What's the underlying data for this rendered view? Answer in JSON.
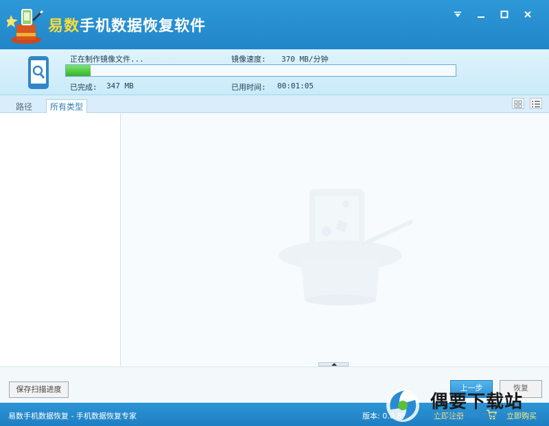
{
  "window": {
    "title_part1": "易数",
    "title_part2": "手机数据恢复软件",
    "controls": [
      "menu-icon",
      "minimize-icon",
      "maximize-icon",
      "close-icon"
    ]
  },
  "progress": {
    "status_text": "正在制作镜像文件...",
    "speed_label": "镜像速度:",
    "speed_value": "370 MB/分钟",
    "completed_label": "已完成:",
    "completed_value": "347 MB",
    "elapsed_label": "已用时间:",
    "elapsed_value": "00:01:05",
    "fill_fraction": 0.064
  },
  "tabs": [
    {
      "label": "路径",
      "active": false
    },
    {
      "label": "所有类型",
      "active": true
    }
  ],
  "view_buttons": [
    "grid-view-icon",
    "list-view-icon"
  ],
  "buttons": {
    "save_scan": "保存扫描进度",
    "prev_step": "上一步",
    "restore": "恢复"
  },
  "statusbar": {
    "left_text": "易数手机数据恢复 - 手机数据恢复专家",
    "version_text": "版本: 0.0.85",
    "register": "立即注册",
    "buy": "立即购买"
  },
  "stamp": {
    "text": "偶要下载站",
    "url": "www.opdown.com"
  },
  "colors": {
    "titlebar": "#2286c8",
    "progress_fill": "#34b52b",
    "accent_yellow": "#f7dc3a"
  }
}
